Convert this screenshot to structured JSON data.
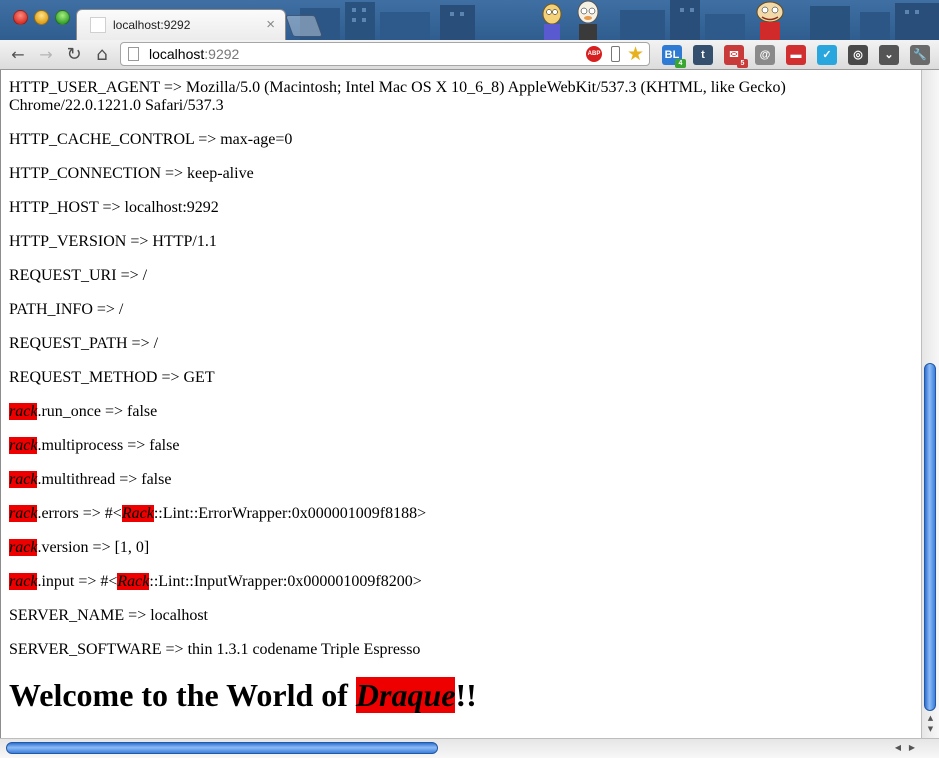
{
  "tab": {
    "title": "localhost:9292",
    "close": "×"
  },
  "omnibox": {
    "host": "localhost",
    "port": ":9292"
  },
  "toolbar": {
    "back": "←",
    "forward": "→",
    "reload": "↻",
    "home": "⌂",
    "abp_label": "ABP",
    "star": "★",
    "extensions": [
      {
        "name": "bl-extension-icon",
        "label": "BL",
        "color": "#2f7ad3",
        "badge": "4"
      },
      {
        "name": "tumblr-icon",
        "label": "t",
        "color": "#35506f",
        "badge": ""
      },
      {
        "name": "mail-icon",
        "label": "✉",
        "color": "#c93b3b",
        "badge": "5"
      },
      {
        "name": "reader-icon",
        "label": "@",
        "color": "#8a8a8a",
        "badge": ""
      },
      {
        "name": "couch-icon",
        "label": "▬",
        "color": "#d23030",
        "badge": ""
      },
      {
        "name": "check-icon",
        "label": "✓",
        "color": "#2aa6df",
        "badge": ""
      },
      {
        "name": "chrome-icon",
        "label": "◎",
        "color": "#4a4a4a",
        "badge": ""
      },
      {
        "name": "pocket-icon",
        "label": "⌄",
        "color": "#555555",
        "badge": ""
      },
      {
        "name": "wrench-icon",
        "label": "🔧",
        "color": "#6a6a6a",
        "badge": ""
      }
    ]
  },
  "env": [
    {
      "key": "HTTP_USER_AGENT",
      "value": "Mozilla/5.0 (Macintosh; Intel Mac OS X 10_6_8) AppleWebKit/537.3 (KHTML, like Gecko) Chrome/22.0.1221.0 Safari/537.3"
    },
    {
      "key": "HTTP_CACHE_CONTROL",
      "value": "max-age=0"
    },
    {
      "key": "HTTP_CONNECTION",
      "value": "keep-alive"
    },
    {
      "key": "HTTP_HOST",
      "value": "localhost:9292"
    },
    {
      "key": "HTTP_VERSION",
      "value": "HTTP/1.1"
    },
    {
      "key": "REQUEST_URI",
      "value": "/"
    },
    {
      "key": "PATH_INFO",
      "value": "/"
    },
    {
      "key": "REQUEST_PATH",
      "value": "/"
    },
    {
      "key": "REQUEST_METHOD",
      "value": "GET"
    }
  ],
  "rack_env": [
    {
      "prefix": "rack",
      "suffix": ".run_once => false",
      "inner_hl": "",
      "tail": ""
    },
    {
      "prefix": "rack",
      "suffix": ".multiprocess => false",
      "inner_hl": "",
      "tail": ""
    },
    {
      "prefix": "rack",
      "suffix": ".multithread => false",
      "inner_hl": "",
      "tail": ""
    },
    {
      "prefix": "rack",
      "suffix": ".errors => #<",
      "inner_hl": "Rack",
      "tail": "::Lint::ErrorWrapper:0x000001009f8188>"
    },
    {
      "prefix": "rack",
      "suffix": ".version => [1, 0]",
      "inner_hl": "",
      "tail": ""
    },
    {
      "prefix": "rack",
      "suffix": ".input => #<",
      "inner_hl": "Rack",
      "tail": "::Lint::InputWrapper:0x000001009f8200>"
    }
  ],
  "server_env": [
    {
      "key": "SERVER_NAME",
      "value": "localhost"
    },
    {
      "key": "SERVER_SOFTWARE",
      "value": "thin 1.3.1 codename Triple Espresso"
    }
  ],
  "arrow": " => ",
  "welcome": {
    "before": "Welcome to the World of ",
    "highlight": "Draque",
    "after": "!!"
  }
}
